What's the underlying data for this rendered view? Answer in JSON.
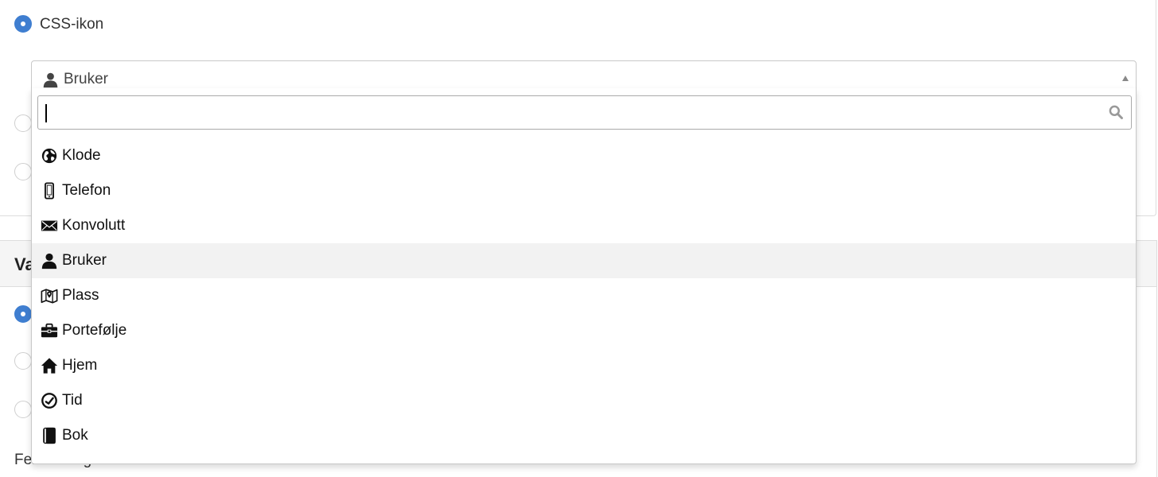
{
  "top_panel": {
    "radio_css_icon": {
      "label": "CSS-ikon",
      "checked": true
    }
  },
  "bottom_panel": {
    "header_title": "Va",
    "bottom_label": "Feilmelding"
  },
  "select": {
    "selected_value": "Bruker",
    "selected_icon": "user-icon",
    "search_value": "",
    "options": [
      {
        "label": "Klode",
        "icon": "globe-icon"
      },
      {
        "label": "Telefon",
        "icon": "phone-icon"
      },
      {
        "label": "Konvolutt",
        "icon": "envelope-icon"
      },
      {
        "label": "Bruker",
        "icon": "user-icon",
        "highlighted": true
      },
      {
        "label": "Plass",
        "icon": "map-icon"
      },
      {
        "label": "Portefølje",
        "icon": "briefcase-icon"
      },
      {
        "label": "Hjem",
        "icon": "home-icon"
      },
      {
        "label": "Tid",
        "icon": "clock-icon"
      },
      {
        "label": "Bok",
        "icon": "book-icon"
      }
    ]
  },
  "colors": {
    "radio_checked": "#3f7ed0",
    "highlight": "#f2f2f2"
  }
}
